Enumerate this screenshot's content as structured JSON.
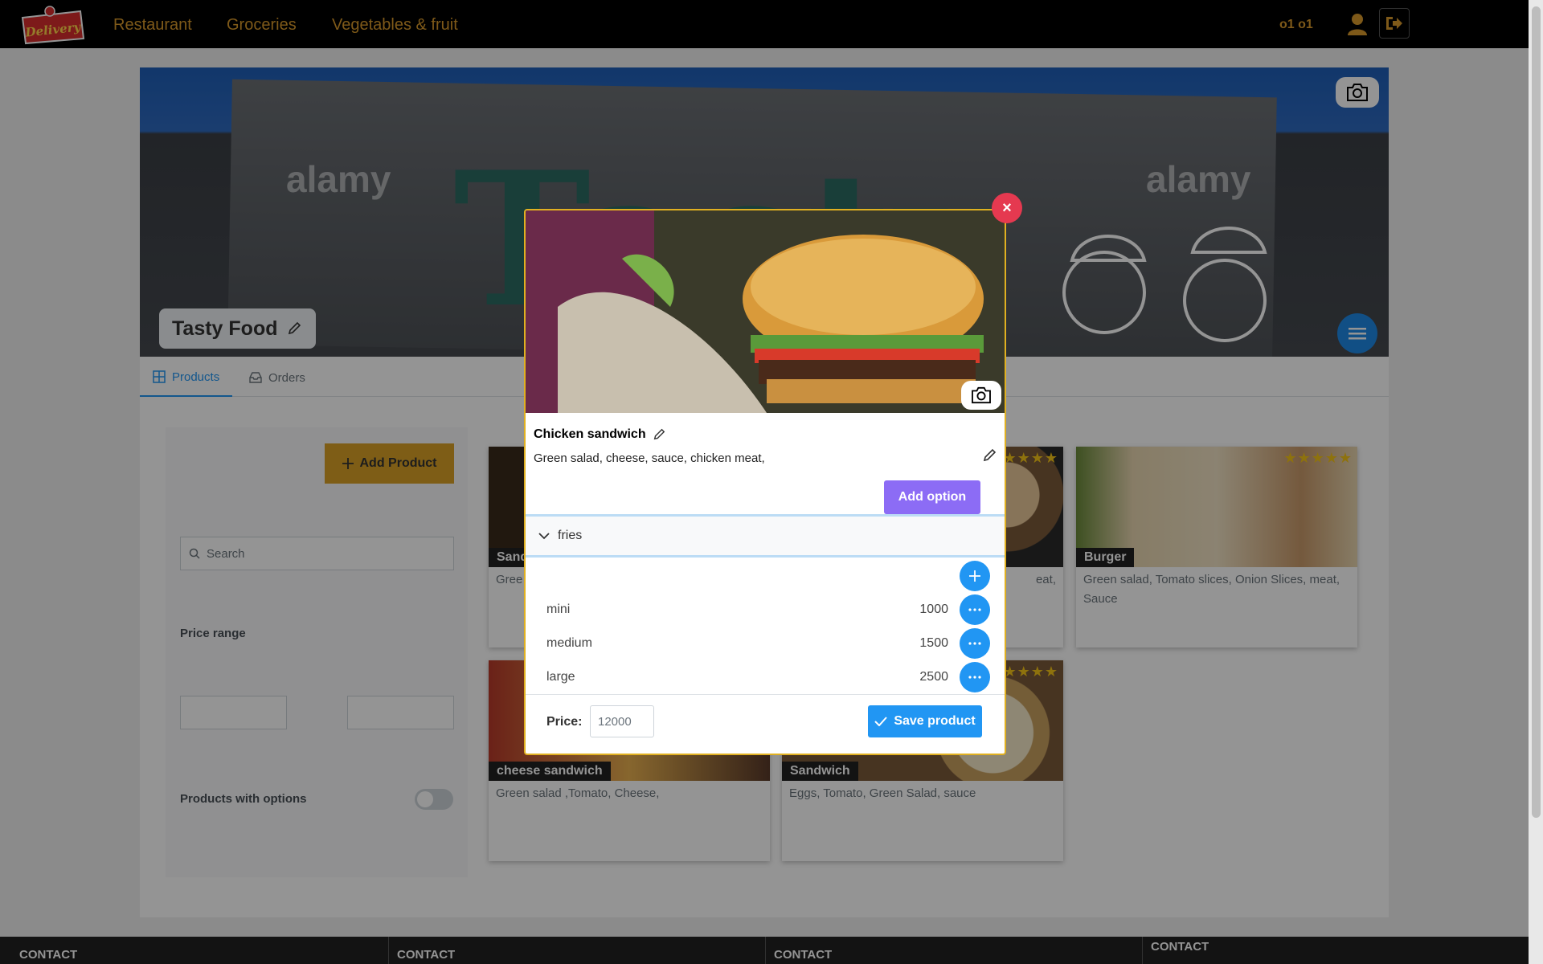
{
  "nav": {
    "logo_text": "Delivery",
    "links": [
      "Restaurant",
      "Groceries",
      "Vegetables & fruit"
    ],
    "user_name": "o1 o1"
  },
  "store": {
    "title": "Tasty Food",
    "banner_watermark": "alamy",
    "banner_letters": "Tasty"
  },
  "tabs": [
    {
      "label": "Products",
      "icon": "grid-icon",
      "active": true
    },
    {
      "label": "Orders",
      "icon": "inbox-icon",
      "active": false
    }
  ],
  "filters": {
    "add_product_label": "Add Product",
    "search_placeholder": "Search",
    "price_range_label": "Price range",
    "products_with_options_label": "Products with options",
    "products_with_options_on": false
  },
  "products": [
    {
      "name": "Sandwich",
      "short_name": "Sand",
      "desc": "Gree"
    },
    {
      "name": "",
      "desc": "eat,"
    },
    {
      "name": "Burger",
      "desc": "Green salad, Tomato slices, Onion Slices, meat, Sauce"
    },
    {
      "name": "cheese sandwich",
      "desc": "Green salad ,Tomato, Cheese,"
    },
    {
      "name": "Sandwich",
      "desc": "Eggs, Tomato, Green Salad, sauce"
    }
  ],
  "modal": {
    "close_label": "×",
    "product_name": "Chicken sandwich",
    "description": "Green salad, cheese, sauce, chicken meat,",
    "add_option_label": "Add option",
    "option_group": "fries",
    "options": [
      {
        "name": "mini",
        "price": "1000"
      },
      {
        "name": "medium",
        "price": "1500"
      },
      {
        "name": "large",
        "price": "2500"
      }
    ],
    "price_label": "Price:",
    "price_value": "12000",
    "save_label": "Save product"
  },
  "footer": {
    "columns": [
      "CONTACT",
      "CONTACT",
      "CONTACT",
      "CONTACT"
    ]
  },
  "colors": {
    "accent": "#d99a2b",
    "primary": "#2196f3",
    "purple": "#8c6cf5",
    "danger": "#e53950",
    "modal_border": "#e0b021"
  }
}
